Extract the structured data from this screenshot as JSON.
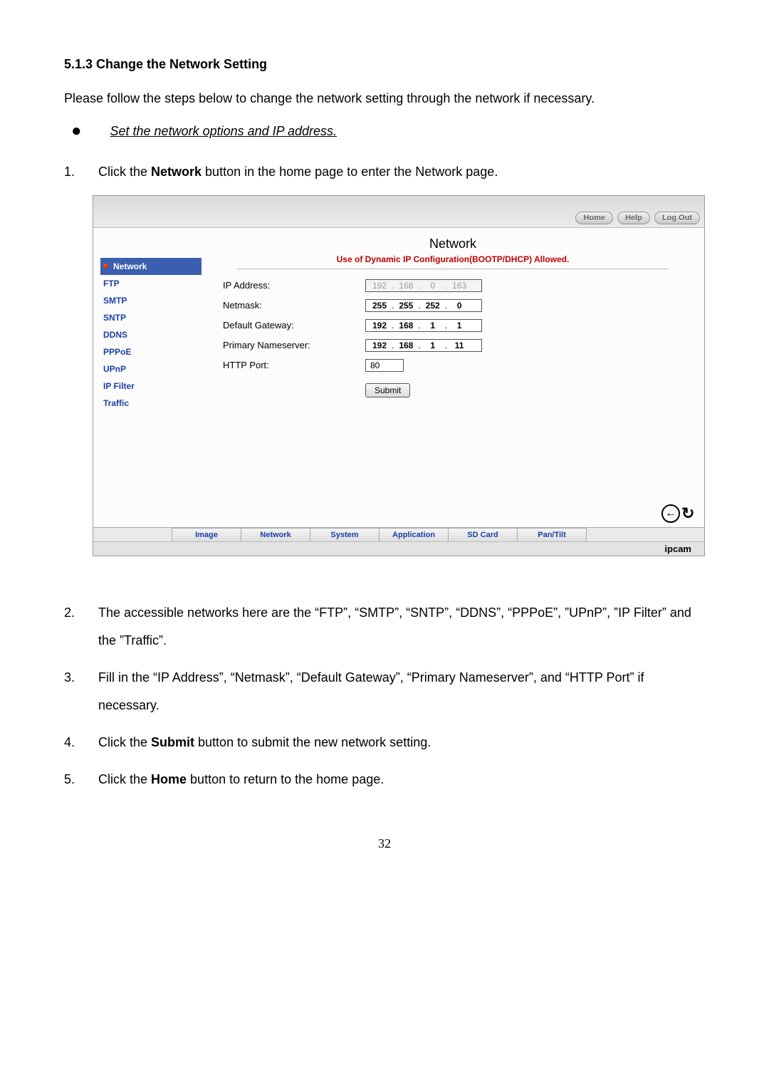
{
  "heading": "5.1.3  Change the Network Setting",
  "intro": "Please follow the steps below to change the network setting through the network if necessary.",
  "bullet": "Set the network options and IP address.",
  "step1_pre": "Click the ",
  "step1_bold": "Network",
  "step1_post": " button in the home page to enter the Network page.",
  "shot": {
    "top_buttons": [
      "Home",
      "Help",
      "Log Out"
    ],
    "sidebar": [
      "Network",
      "FTP",
      "SMTP",
      "SNTP",
      "DDNS",
      "PPPoE",
      "UPnP",
      "IP Filter",
      "Traffic"
    ],
    "title": "Network",
    "dhcp_msg": "Use of Dynamic IP Configuration(BOOTP/DHCP) Allowed.",
    "rows": {
      "ip_label": "IP Address:",
      "ip": [
        "192",
        "168",
        "0",
        "163"
      ],
      "nm_label": "Netmask:",
      "nm": [
        "255",
        "255",
        "252",
        "0"
      ],
      "gw_label": "Default Gateway:",
      "gw": [
        "192",
        "168",
        "1",
        "1"
      ],
      "ns_label": "Primary Nameserver:",
      "ns": [
        "192",
        "168",
        "1",
        "11"
      ],
      "port_label": "HTTP Port:",
      "port": "80"
    },
    "submit": "Submit",
    "tabs": [
      "Image",
      "Network",
      "System",
      "Application",
      "SD Card",
      "Pan/Tilt"
    ],
    "brand": "ipcam"
  },
  "step2": "The accessible networks here are the “FTP”, “SMTP”, “SNTP”, “DDNS”, “PPPoE”, ”UPnP”, ”IP Filter” and the ”Traffic”.",
  "step3": "Fill in the “IP Address”, “Netmask”, “Default Gateway”, “Primary Nameserver”, and “HTTP Port” if necessary.",
  "step4_pre": "Click the ",
  "step4_bold": "Submit",
  "step4_post": " button to submit the new network setting.",
  "step5_pre": "Click the ",
  "step5_bold": "Home",
  "step5_post": " button to return to the home page.",
  "page_number": "32"
}
